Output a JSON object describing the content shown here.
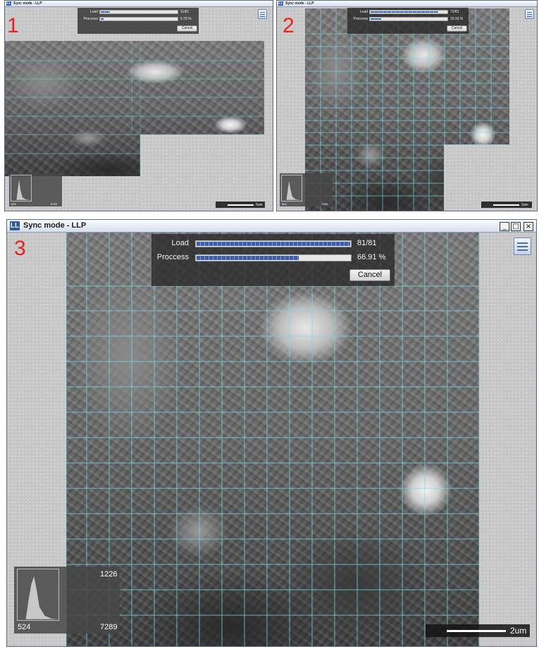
{
  "panel_numbers": [
    "1",
    "2",
    "3"
  ],
  "app": {
    "icon_text": "LL",
    "title_small": "Sync mode - LLP",
    "title_large": "Sync mode - LLP"
  },
  "window_controls": {
    "minimize": "_",
    "maximize": "□",
    "close": "×"
  },
  "progress_labels": {
    "load": "Load",
    "process": "Proccess",
    "cancel": "Cancel"
  },
  "panels": [
    {
      "load_value": "11/81",
      "load_fraction": 0.136,
      "process_value": "5.79 %",
      "process_fraction": 0.058,
      "histogram": {
        "min": "826",
        "max": "6793"
      },
      "scale_label": "5um"
    },
    {
      "load_value": "72/81",
      "load_fraction": 0.889,
      "process_value": "15.93 %",
      "process_fraction": 0.159,
      "histogram": {
        "min": "524",
        "max": "7289"
      },
      "scale_label": "2um"
    },
    {
      "load_value": "81/81",
      "load_fraction": 1.0,
      "process_value": "66.91 %",
      "process_fraction": 0.669,
      "histogram": {
        "min": "524",
        "max": "7289",
        "peak": "1226"
      },
      "scale_label": "2um"
    }
  ],
  "icons": [
    "app-icon",
    "menu-icon",
    "histogram-icon",
    "minimize-icon",
    "maximize-icon",
    "close-icon"
  ]
}
